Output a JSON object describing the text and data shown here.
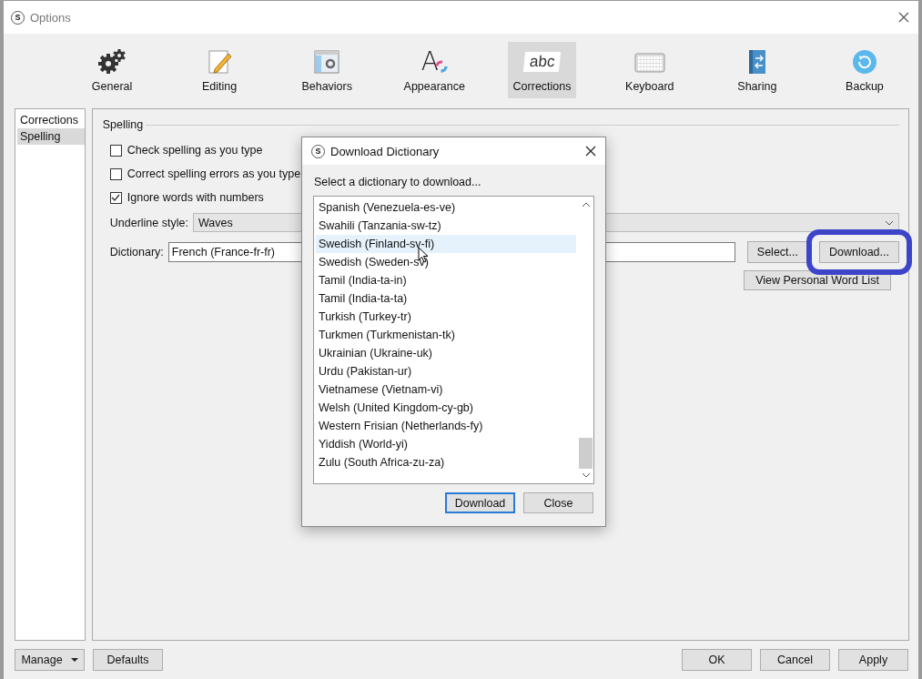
{
  "window": {
    "title": "Options",
    "app_icon": "S"
  },
  "tabs": [
    {
      "label": "General",
      "kind": "gears",
      "selected": false
    },
    {
      "label": "Editing",
      "kind": "pencil",
      "selected": false
    },
    {
      "label": "Behaviors",
      "kind": "window",
      "selected": false
    },
    {
      "label": "Appearance",
      "kind": "letter",
      "icon_text": "A",
      "selected": false
    },
    {
      "label": "Corrections",
      "kind": "card",
      "icon_text": "abc",
      "selected": true
    },
    {
      "label": "Keyboard",
      "kind": "keyboard",
      "selected": false
    },
    {
      "label": "Sharing",
      "kind": "book",
      "selected": false
    },
    {
      "label": "Backup",
      "kind": "restore",
      "selected": false
    }
  ],
  "sidebar": {
    "items": [
      {
        "label": "Corrections",
        "selected": false
      },
      {
        "label": "Spelling",
        "selected": true
      }
    ]
  },
  "spelling": {
    "title": "Spelling",
    "options": [
      {
        "label": "Check spelling as you type",
        "checked": false
      },
      {
        "label": "Correct spelling errors as you type",
        "checked": false
      },
      {
        "label": "Ignore words with numbers",
        "checked": true
      }
    ],
    "underline_style": {
      "label": "Underline style:",
      "value": "Waves"
    },
    "dictionary": {
      "label": "Dictionary:",
      "value": "French (France-fr-fr)"
    },
    "buttons": [
      {
        "label": "Select..."
      },
      {
        "label": "Download...",
        "highlighted": true
      }
    ],
    "word_list_button": "View Personal Word List"
  },
  "footer": {
    "left": [
      {
        "label": "Manage",
        "menu": true
      },
      {
        "label": "Defaults",
        "menu": false
      }
    ],
    "right": [
      "OK",
      "Cancel",
      "Apply"
    ]
  },
  "dialog": {
    "title": "Download Dictionary",
    "app_icon": "S",
    "prompt": "Select a dictionary to download...",
    "items": [
      {
        "label": "Spanish (Venezuela-es-ve)",
        "selected": false
      },
      {
        "label": "Swahili (Tanzania-sw-tz)",
        "selected": false
      },
      {
        "label": "Swedish (Finland-sv-fi)",
        "selected": true
      },
      {
        "label": "Swedish (Sweden-sv)",
        "selected": false
      },
      {
        "label": "Tamil (India-ta-in)",
        "selected": false
      },
      {
        "label": "Tamil (India-ta-ta)",
        "selected": false
      },
      {
        "label": "Turkish (Turkey-tr)",
        "selected": false
      },
      {
        "label": "Turkmen (Turkmenistan-tk)",
        "selected": false
      },
      {
        "label": "Ukrainian (Ukraine-uk)",
        "selected": false
      },
      {
        "label": "Urdu (Pakistan-ur)",
        "selected": false
      },
      {
        "label": "Vietnamese (Vietnam-vi)",
        "selected": false
      },
      {
        "label": "Welsh (United Kingdom-cy-gb)",
        "selected": false
      },
      {
        "label": "Western Frisian (Netherlands-fy)",
        "selected": false
      },
      {
        "label": "Yiddish (World-yi)",
        "selected": false
      },
      {
        "label": "Zulu (South Africa-zu-za)",
        "selected": false
      }
    ],
    "buttons": [
      {
        "label": "Download",
        "default": true
      },
      {
        "label": "Close",
        "default": false
      }
    ]
  }
}
